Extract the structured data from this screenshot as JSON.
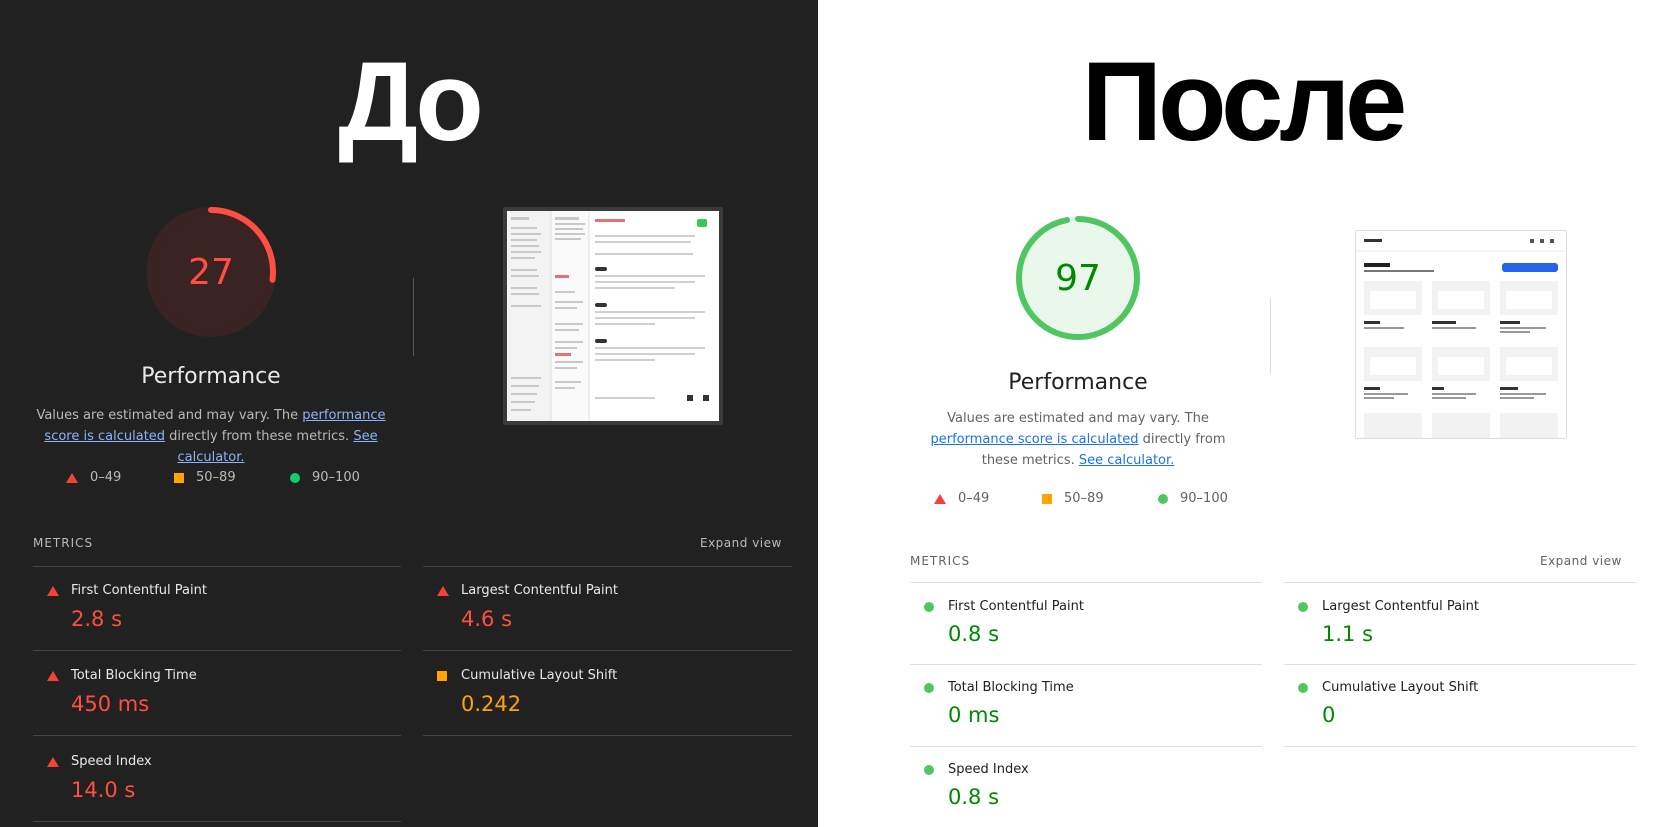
{
  "before": {
    "heading": "До",
    "score": "27",
    "score_value": 27,
    "performance_label": "Performance",
    "description": {
      "prefix": "Values are estimated and may vary. The ",
      "link1": "performance score is calculated",
      "middle": " directly from these metrics.",
      "link2": "See calculator."
    },
    "legend": [
      "0–49",
      "50–89",
      "90–100"
    ],
    "metrics_label": "METRICS",
    "expand_label": "Expand view",
    "metrics": [
      {
        "title": "First Contentful Paint",
        "value": "2.8 s",
        "status": "fail"
      },
      {
        "title": "Largest Contentful Paint",
        "value": "4.6 s",
        "status": "fail"
      },
      {
        "title": "Total Blocking Time",
        "value": "450 ms",
        "status": "fail"
      },
      {
        "title": "Cumulative Layout Shift",
        "value": "0.242",
        "status": "average"
      },
      {
        "title": "Speed Index",
        "value": "14.0 s",
        "status": "fail"
      }
    ]
  },
  "after": {
    "heading": "После",
    "score": "97",
    "score_value": 97,
    "performance_label": "Performance",
    "description": {
      "prefix": "Values are estimated and may vary. The ",
      "link1": "performance score is calculated",
      "middle": " directly from these metrics.",
      "link2": "See calculator."
    },
    "legend": [
      "0–49",
      "50–89",
      "90–100"
    ],
    "metrics_label": "METRICS",
    "expand_label": "Expand view",
    "metrics": [
      {
        "title": "First Contentful Paint",
        "value": "0.8 s",
        "status": "pass"
      },
      {
        "title": "Largest Contentful Paint",
        "value": "1.1 s",
        "status": "pass"
      },
      {
        "title": "Total Blocking Time",
        "value": "0 ms",
        "status": "pass"
      },
      {
        "title": "Cumulative Layout Shift",
        "value": "0",
        "status": "pass"
      },
      {
        "title": "Speed Index",
        "value": "0.8 s",
        "status": "pass"
      }
    ]
  },
  "colors": {
    "fail": "#ff4e42",
    "average": "#ffa400",
    "pass": "#0cce6b"
  }
}
